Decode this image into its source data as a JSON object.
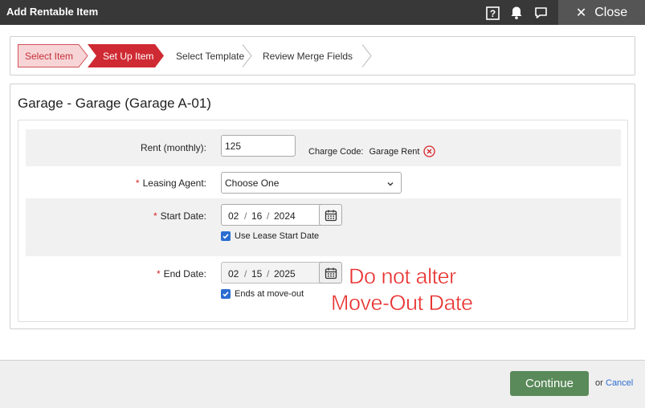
{
  "window": {
    "title": "Add Rentable Item",
    "close_label": "Close"
  },
  "header_icons": [
    "help-icon",
    "bell-icon",
    "chat-icon"
  ],
  "steps": [
    {
      "label": "Select Item",
      "state": "completed"
    },
    {
      "label": "Set Up Item",
      "state": "active"
    },
    {
      "label": "Select Template",
      "state": "pending"
    },
    {
      "label": "Review Merge Fields",
      "state": "pending"
    }
  ],
  "item_title": "Garage - Garage (Garage A-01)",
  "form": {
    "rent": {
      "label": "Rent (monthly):",
      "value": "125"
    },
    "charge_code": {
      "label": "Charge Code:",
      "value": "Garage Rent"
    },
    "leasing_agent": {
      "required": "*",
      "label": "Leasing Agent:",
      "selected": "Choose One"
    },
    "start_date": {
      "required": "*",
      "label": "Start Date:",
      "month": "02",
      "day": "16",
      "year": "2024",
      "sep": "/",
      "checkbox_label": "Use Lease Start Date",
      "checked": true
    },
    "end_date": {
      "required": "*",
      "label": "End Date:",
      "month": "02",
      "day": "15",
      "year": "2025",
      "sep": "/",
      "checkbox_label": "Ends at move-out",
      "checked": true
    }
  },
  "annotation": {
    "line1": "Do not alter",
    "line2": "Move-Out Date"
  },
  "footer": {
    "continue_label": "Continue",
    "or_text": "or",
    "cancel_label": "Cancel"
  },
  "colors": {
    "header_bg": "#383838",
    "step_active": "#cf2a33",
    "step_completed": "#f7d5d7",
    "continue_bg": "#5a8a5a",
    "checkbox": "#2a6dd1",
    "annotation": "#e8312f"
  }
}
